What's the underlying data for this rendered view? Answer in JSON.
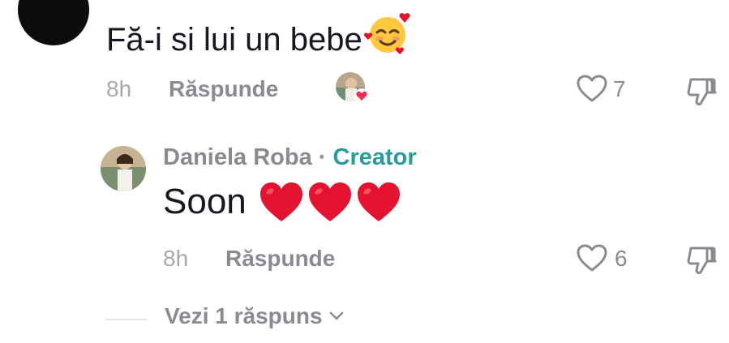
{
  "top_comment": {
    "text": "Fă-i si lui un bebe",
    "time": "8h",
    "reply_label": "Răspunde",
    "like_count": "7",
    "emoji": "smiling-face-with-hearts"
  },
  "reply": {
    "author": "Daniela Roba",
    "separator": "·",
    "badge": "Creator",
    "text": "Soon",
    "emoji": "red-heart x3",
    "time": "8h",
    "reply_label": "Răspunde",
    "like_count": "6"
  },
  "view_more": {
    "label": "Vezi 1 răspuns"
  },
  "colors": {
    "text": "#161823",
    "muted": "#8a8b91",
    "time": "#a8a8ad",
    "creator": "#2a9b9d",
    "heart": "#e4132f"
  }
}
